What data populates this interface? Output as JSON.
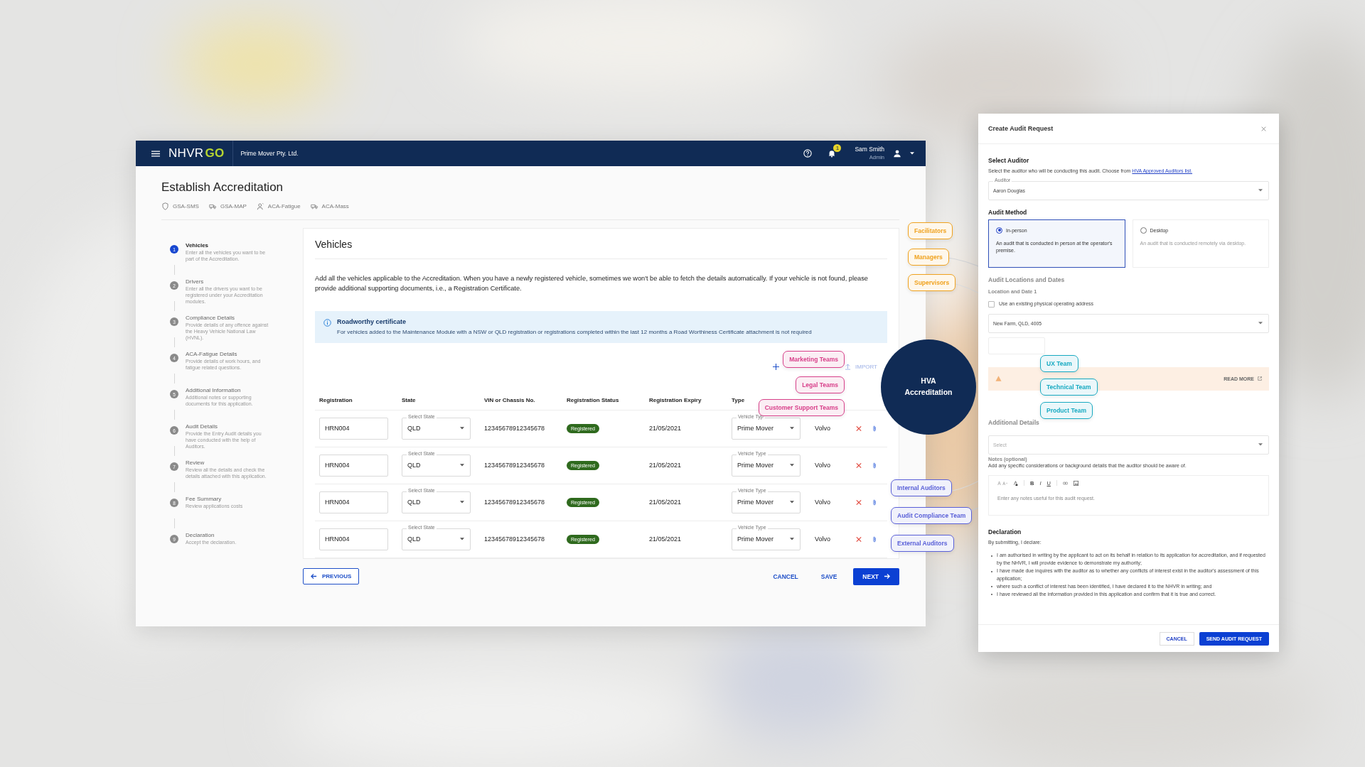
{
  "app_bar": {
    "brand": "NHVR",
    "brand_accent": "GO",
    "company": "Prime Mover Pty. Ltd.",
    "notifications": "1",
    "user_name": "Sam Smith",
    "user_role": "Admin"
  },
  "page": {
    "title": "Establish Accreditation",
    "modules": [
      {
        "label": "GSA-SMS",
        "kind": "shield"
      },
      {
        "label": "GSA-MAP",
        "kind": "truck"
      },
      {
        "label": "ACA-Fatigue",
        "kind": "person"
      },
      {
        "label": "ACA-Mass",
        "kind": "truck"
      }
    ]
  },
  "steps": [
    {
      "number": "1",
      "title": "Vehicles",
      "description": "Enter all the vehicles you want to be part of the Accreditation.",
      "selected": true
    },
    {
      "number": "2",
      "title": "Drivers",
      "description": "Enter all the drivers you want to be registered under your Accreditation modules.",
      "selected": false
    },
    {
      "number": "3",
      "title": "Compliance Details",
      "description": "Provide details of any offence against the Heavy Vehicle National Law (HVNL).",
      "selected": false
    },
    {
      "number": "4",
      "title": "ACA-Fatigue Details",
      "description": "Provide details of work hours, and fatigue related questions.",
      "selected": false
    },
    {
      "number": "5",
      "title": "Additional Information",
      "description": "Additional notes or supporting documents for this application.",
      "selected": false
    },
    {
      "number": "6",
      "title": "Audit Details",
      "description": "Provide the Entry Audit details you have conducted with the help of Auditors.",
      "selected": false
    },
    {
      "number": "7",
      "title": "Review",
      "description": "Review all the details and check the details attached with this application.",
      "selected": false
    },
    {
      "number": "8",
      "title": "Fee Summary",
      "description": "Review applications costs",
      "selected": false
    },
    {
      "number": "9",
      "title": "Declaration",
      "description": "Accept the declaration.",
      "selected": false
    }
  ],
  "vehicles": {
    "title": "Vehicles",
    "intro": "Add all the vehicles applicable to the Accreditation. When you have a newly registered vehicle, sometimes we won't be able to fetch the details automatically. If your vehicle is not found, please provide additional supporting documents, i.e., a Registration Certificate.",
    "notice": {
      "title": "Roadworthy certificate",
      "text": "For vehicles added to the Maintenance Module with a NSW or QLD registration or registrations completed within the last 12 months a Road Worthiness Certificate attachment is not required"
    },
    "import_label": "IMPORT",
    "columns": [
      "Registration",
      "State",
      "VIN or Chassis No.",
      "Registration Status",
      "Registration Expiry",
      "Type"
    ],
    "rows": [
      {
        "registration": "HRN004",
        "state_label": "Select State",
        "state": "QLD",
        "vin": "12345678912345678",
        "status": "Registered",
        "expiry": "21/05/2021",
        "type_label": "Vehicle Typ",
        "type": "Prime Mover",
        "make": "Volvo"
      },
      {
        "registration": "HRN004",
        "state_label": "Select State",
        "state": "QLD",
        "vin": "12345678912345678",
        "status": "Registered",
        "expiry": "21/05/2021",
        "type_label": "Vehicle Type",
        "type": "Prime Mover",
        "make": "Volvo"
      },
      {
        "registration": "HRN004",
        "state_label": "Select State",
        "state": "QLD",
        "vin": "12345678912345678",
        "status": "Registered",
        "expiry": "21/05/2021",
        "type_label": "Vehicle Type",
        "type": "Prime Mover",
        "make": "Volvo"
      },
      {
        "registration": "HRN004",
        "state_label": "Select State",
        "state": "QLD",
        "vin": "12345678912345678",
        "status": "Registered",
        "expiry": "21/05/2021",
        "type_label": "Vehicle Type",
        "type": "Prime Mover",
        "make": "Volvo"
      }
    ]
  },
  "footer": {
    "previous": "PREVIOUS",
    "cancel": "CANCEL",
    "save": "SAVE",
    "next": "NEXT"
  },
  "diagram": {
    "center": "HVA Accreditation",
    "groups": [
      {
        "color": "#f0a21e",
        "items": [
          "Facilitators",
          "Managers",
          "Supervisors"
        ]
      },
      {
        "color": "#d8408a",
        "items": [
          "Marketing Teams",
          "Legal Teams",
          "Customer Support Teams"
        ]
      },
      {
        "color": "#5a60d8",
        "items": [
          "Internal Auditors",
          "Audit Compliance Team",
          "External Auditors"
        ]
      },
      {
        "color": "#17aac2",
        "items": [
          "UX Team",
          "Technical Team",
          "Product Team"
        ]
      }
    ]
  },
  "dialog": {
    "title": "Create Audit Request",
    "auditor": {
      "heading": "Select Auditor",
      "hint": "Select the auditor who will be conducting this audit. Choose from",
      "link": "HVA Approved Auditors list.",
      "field_label": "Auditor",
      "value": "Aaron Douglas"
    },
    "method": {
      "heading": "Audit Method",
      "options": [
        {
          "label": "In-person",
          "description": "An audit that is conducted in person at the operator's premise.",
          "selected": true
        },
        {
          "label": "Desktop",
          "description": "An audit that is conducted remotely via desktop.",
          "selected": false
        }
      ]
    },
    "locations": {
      "heading": "Audit Locations and Dates",
      "subheading": "Location and Date 1",
      "checkbox": {
        "label": "Use an existing physical operating address",
        "checked": false
      },
      "address": "New Farm, QLD, 4005",
      "read_more": "READ MORE"
    },
    "additional": {
      "heading": "Additional Details",
      "select_placeholder": "Select",
      "notes_label": "Notes (optional)",
      "notes_hint": "Add any specific considerations or background details that the auditor should be aware of.",
      "notes_placeholder": "Enter any notes useful for this audit request.",
      "format_buttons": [
        "B",
        "I",
        "U"
      ]
    },
    "declaration": {
      "heading": "Declaration",
      "intro": "By submitting, I declare:",
      "items": [
        "I am authorised in writing by the applicant to act on its behalf in relation to its application for accreditation, and if requested by the NHVR, I will provide evidence to demonstrate my authority;",
        "I have made due inquires with the auditor as to whether any conflicts of interest exist in the auditor's assessment of this application;",
        "where such a conflict of interest has been identified, I have declared it to the NHVR in writing; and",
        "I have reviewed all the information provided in this application and confirm that it is true and correct."
      ]
    },
    "buttons": {
      "cancel": "CANCEL",
      "submit": "SEND AUDIT REQUEST"
    }
  }
}
